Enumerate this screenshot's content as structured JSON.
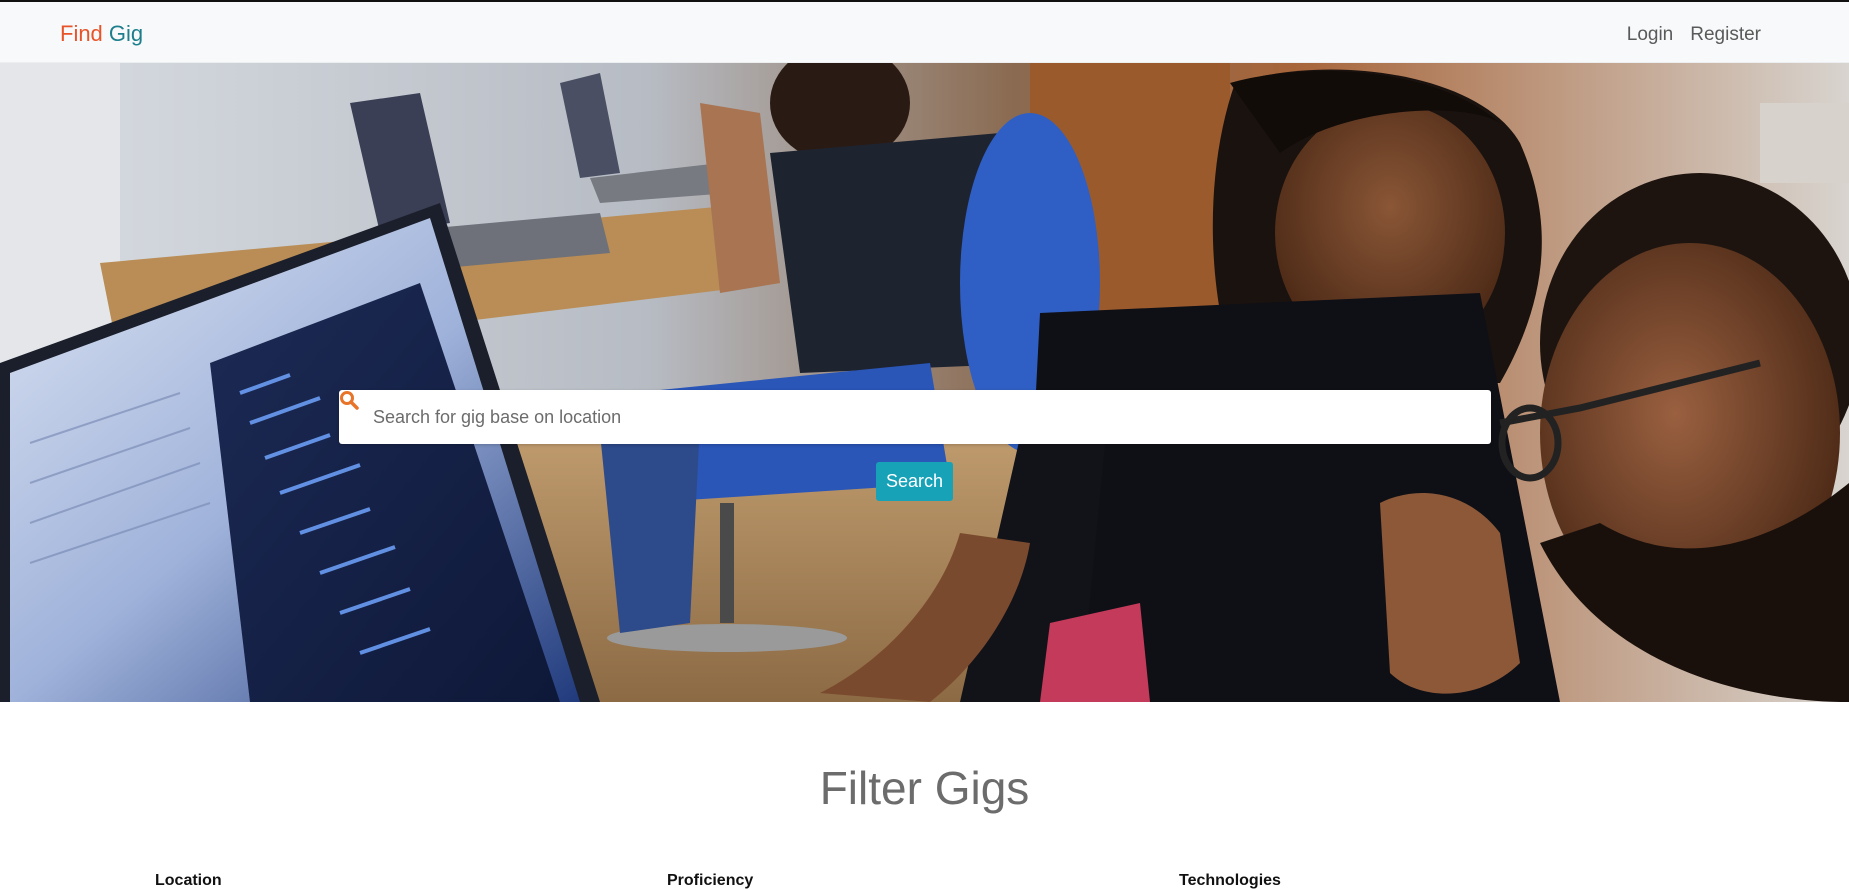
{
  "navbar": {
    "brand_part1": "Find",
    "brand_part2": "Gig",
    "links": [
      {
        "label": "Login"
      },
      {
        "label": "Register"
      }
    ]
  },
  "hero": {
    "search": {
      "placeholder": "Search for gig base on location",
      "value": "",
      "icon": "search-icon"
    },
    "search_button_label": "Search"
  },
  "filters": {
    "title": "Filter Gigs",
    "groups": [
      {
        "label": "Location"
      },
      {
        "label": "Proficiency"
      },
      {
        "label": "Technologies"
      }
    ]
  },
  "colors": {
    "brand_find": "#e8542a",
    "brand_gig": "#1d7f8c",
    "search_button": "#17a2b8",
    "search_icon": "#e8742a"
  }
}
